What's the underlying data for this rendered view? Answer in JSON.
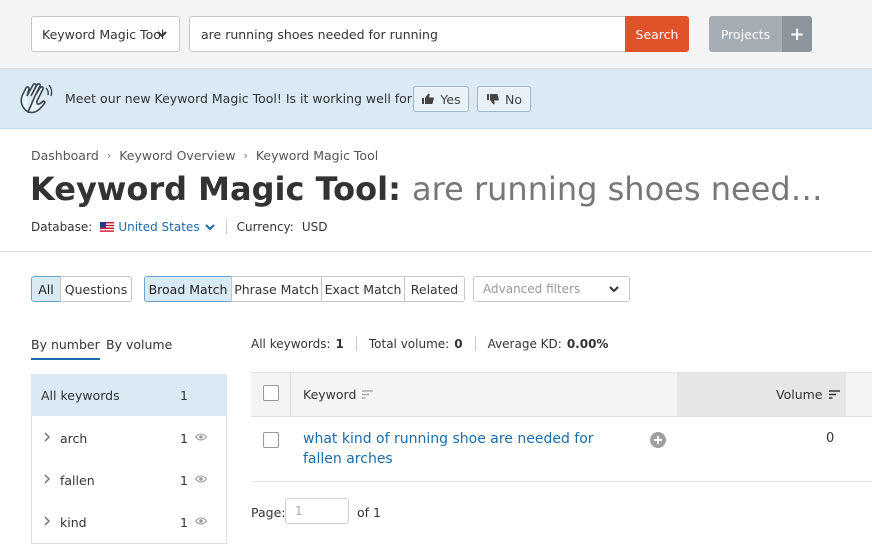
{
  "topbar": {
    "tool_select": "Keyword Magic Tool",
    "search_value": "are running shoes needed for running",
    "search_button": "Search",
    "projects_button": "Projects",
    "projects_plus": "+"
  },
  "banner": {
    "text": "Meet our new Keyword Magic Tool! Is it working well for you?",
    "yes": "Yes",
    "no": "No"
  },
  "breadcrumb": [
    "Dashboard",
    "Keyword Overview",
    "Keyword Magic Tool"
  ],
  "title": {
    "prefix": "Keyword Magic Tool:",
    "query": "are running shoes need…"
  },
  "database": {
    "label": "Database:",
    "value": "United States",
    "currency_label": "Currency:",
    "currency_value": "USD"
  },
  "filters": {
    "all": "All",
    "questions": "Questions",
    "broad": "Broad Match",
    "phrase": "Phrase Match",
    "exact": "Exact Match",
    "related": "Related",
    "advanced_placeholder": "Advanced filters"
  },
  "group_tabs": {
    "by_number": "By number",
    "by_volume": "By volume"
  },
  "groups": [
    {
      "label": "All keywords",
      "count": "1"
    },
    {
      "label": "arch",
      "count": "1"
    },
    {
      "label": "fallen",
      "count": "1"
    },
    {
      "label": "kind",
      "count": "1"
    }
  ],
  "stats": {
    "all_keywords_label": "All keywords:",
    "all_keywords_value": "1",
    "total_volume_label": "Total volume:",
    "total_volume_value": "0",
    "avg_kd_label": "Average KD:",
    "avg_kd_value": "0.00%"
  },
  "table": {
    "col_keyword": "Keyword",
    "col_volume": "Volume",
    "rows": [
      {
        "keyword": "what kind of running shoe are needed for fallen arches",
        "volume": "0"
      }
    ]
  },
  "pagination": {
    "label": "Page:",
    "current": "1",
    "of": "of 1"
  },
  "colors": {
    "accent_orange": "#e0522a",
    "link_blue": "#1a6ca8",
    "banner_bg": "#d9eaf5"
  }
}
